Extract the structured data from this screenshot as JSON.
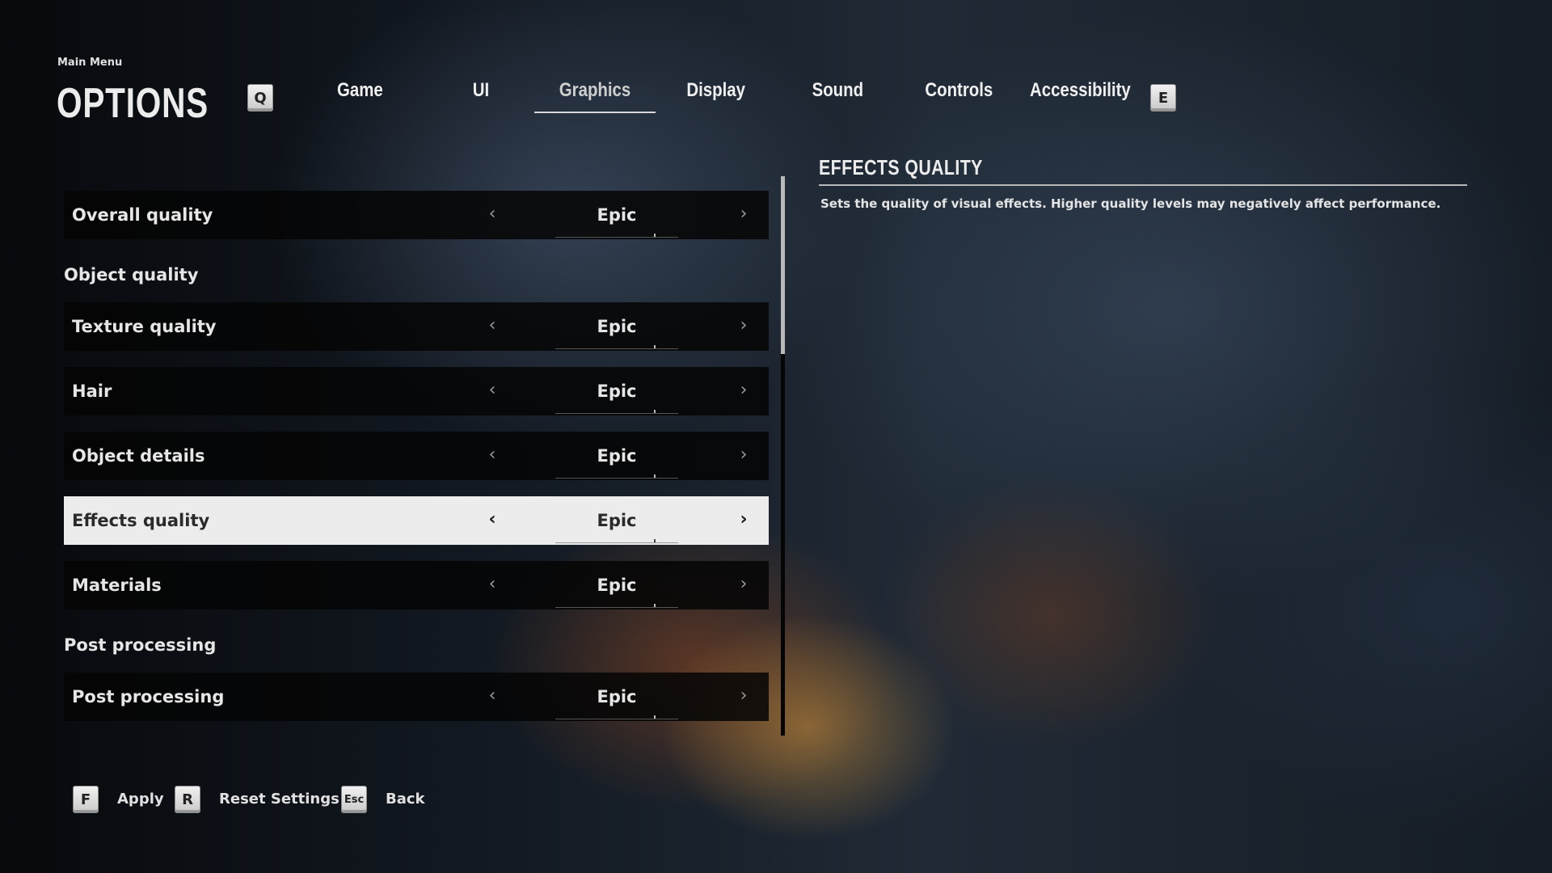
{
  "header": {
    "breadcrumb": "Main Menu",
    "title": "OPTIONS",
    "prev_tab_key": "Q",
    "next_tab_key": "E"
  },
  "tabs": [
    {
      "label": "Game",
      "active": false
    },
    {
      "label": "UI",
      "active": false
    },
    {
      "label": "Graphics",
      "active": true
    },
    {
      "label": "Display",
      "active": false
    },
    {
      "label": "Sound",
      "active": false
    },
    {
      "label": "Controls",
      "active": false
    },
    {
      "label": "Accessibility",
      "active": false
    }
  ],
  "settings": {
    "overall": {
      "label": "Overall quality",
      "value": "Epic"
    },
    "section_object": "Object quality",
    "texture": {
      "label": "Texture quality",
      "value": "Epic"
    },
    "hair": {
      "label": "Hair",
      "value": "Epic"
    },
    "object_details": {
      "label": "Object details",
      "value": "Epic"
    },
    "effects": {
      "label": "Effects quality",
      "value": "Epic",
      "selected": true
    },
    "materials": {
      "label": "Materials",
      "value": "Epic"
    },
    "section_post": "Post processing",
    "post": {
      "label": "Post processing",
      "value": "Epic"
    }
  },
  "arrows": {
    "left": "‹",
    "right": "›"
  },
  "description": {
    "title": "EFFECTS QUALITY",
    "text": "Sets the quality of visual effects. Higher quality levels may negatively affect performance."
  },
  "footer": {
    "apply": {
      "key": "F",
      "label": "Apply"
    },
    "reset": {
      "key": "R",
      "label": "Reset Settings"
    },
    "back": {
      "key": "Esc",
      "label": "Back"
    }
  },
  "colors": {
    "selected_row": "#ececec",
    "row_bg": "#050505",
    "accent_glow": "#d6963c"
  }
}
